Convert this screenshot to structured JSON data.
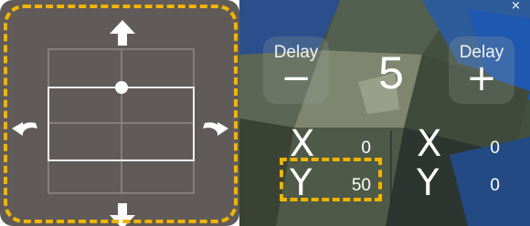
{
  "colors": {
    "pad_background": "#605b59",
    "highlight": "#f1b400",
    "grid_line": "#c9c6c4",
    "text": "#ffffff"
  },
  "pad": {
    "arrows": {
      "up": "arrow-up-icon",
      "down": "arrow-down-icon",
      "rotate_left": "rotate-left-icon",
      "rotate_right": "rotate-right-icon"
    }
  },
  "delay": {
    "minus_label": "Delay",
    "minus_symbol": "−",
    "plus_label": "Delay",
    "plus_symbol": "+",
    "value": "5"
  },
  "coords": {
    "left": {
      "x_label": "X",
      "x_value": "0",
      "y_label": "Y",
      "y_value": "50"
    },
    "right": {
      "x_label": "X",
      "x_value": "0",
      "y_label": "Y",
      "y_value": "0"
    }
  },
  "corner_mark": "×"
}
